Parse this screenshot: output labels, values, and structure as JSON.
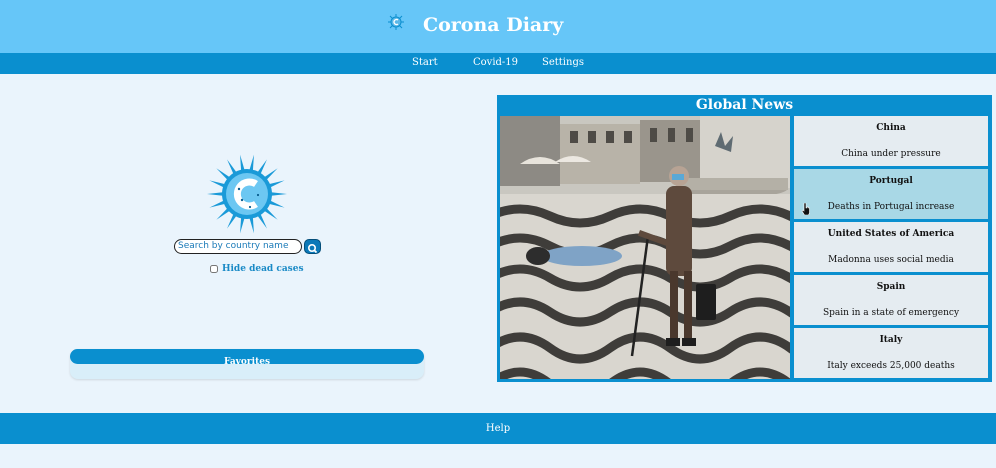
{
  "header": {
    "title": "Corona Diary",
    "logo_icon": "corona-logo-icon"
  },
  "nav": {
    "items": [
      {
        "label": "Start"
      },
      {
        "label": "Covid-19"
      },
      {
        "label": "Settings"
      }
    ]
  },
  "search": {
    "placeholder": "Search by country name",
    "value": "",
    "button_icon": "search-icon"
  },
  "filters": {
    "hide_dead_cases_label": "Hide dead cases",
    "hide_dead_cases_checked": false
  },
  "favorites": {
    "title": "Favorites",
    "items": []
  },
  "news": {
    "title": "Global News",
    "photo_icon": "news-photo-image",
    "items": [
      {
        "country": "China",
        "headline": "China under pressure"
      },
      {
        "country": "Portugal",
        "headline": "Deaths in Portugal increase"
      },
      {
        "country": "United States of America",
        "headline": "Madonna uses social media"
      },
      {
        "country": "Spain",
        "headline": "Spain in a state of emergency"
      },
      {
        "country": "Italy",
        "headline": "Italy exceeds 25,000 deaths"
      }
    ]
  },
  "footer": {
    "help_label": "Help"
  },
  "colors": {
    "header_bg": "#66c6f8",
    "bar_bg": "#0a8fcf",
    "page_bg": "#eaf4fc",
    "news_item_bg": "#e5ecf1",
    "news_item_hover_bg": "#a9d8e6"
  }
}
